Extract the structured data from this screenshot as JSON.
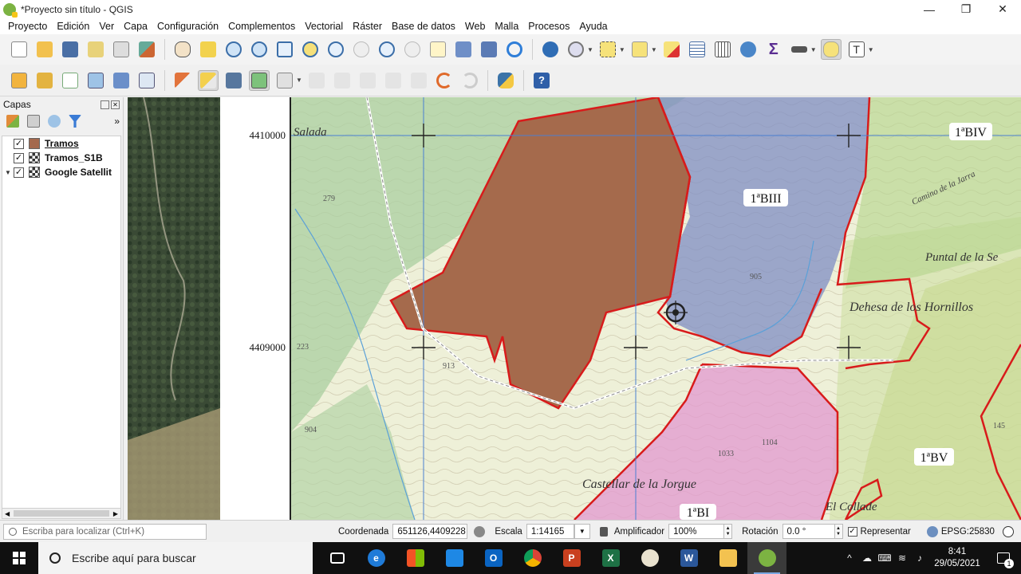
{
  "window": {
    "title": "*Proyecto sin título - QGIS",
    "minimize": "—",
    "maximize": "❐",
    "close": "✕"
  },
  "menu": [
    "Proyecto",
    "Edición",
    "Ver",
    "Capa",
    "Configuración",
    "Complementos",
    "Vectorial",
    "Ráster",
    "Base de datos",
    "Web",
    "Malla",
    "Procesos",
    "Ayuda"
  ],
  "colors": {
    "accent_line": "#d81b1b",
    "polygon_brown": "#a56a4c",
    "zone_blue": "#7f8dc4",
    "zone_pink": "#e39bd0",
    "zone_green": "#b7d68f"
  },
  "layers_panel": {
    "title": "Capas",
    "more": "»",
    "layers": [
      {
        "name": "Tramos",
        "checked": "✓",
        "symbol": "fill",
        "expander": ""
      },
      {
        "name": "Tramos_S1B",
        "checked": "✓",
        "symbol": "raster",
        "expander": ""
      },
      {
        "name": "Google Satellit",
        "checked": "✓",
        "symbol": "raster",
        "expander": "▼"
      }
    ]
  },
  "map": {
    "coord_labels": [
      "4410000",
      "4409000"
    ],
    "zone_labels": [
      "1ªBIV",
      "1ªBIII",
      "1ªBV",
      "1ªBI"
    ],
    "place_names": [
      "Dehesa de los Hornillos",
      "Castellar de la Jorgue",
      "Puntal de la Se",
      "El Collade",
      "Camino de la Jarra",
      "Salada"
    ],
    "elevations": [
      "279",
      "223",
      "913",
      "904",
      "905",
      "1033",
      "1104",
      "145"
    ]
  },
  "status": {
    "locator_placeholder": "Escriba para localizar (Ctrl+K)",
    "coordinate_label": "Coordenada",
    "coordinate_value": "651126,4409228",
    "scale_label": "Escala",
    "scale_value": "1:14165",
    "magnifier_label": "Amplificador",
    "magnifier_value": "100%",
    "rotation_label": "Rotación",
    "rotation_value": "0.0 °",
    "render_label": "Representar",
    "render_checked": "✓",
    "crs": "EPSG:25830"
  },
  "taskbar": {
    "search_placeholder": "Escribe aquí para buscar",
    "time": "8:41",
    "date": "29/05/2021",
    "notifications": "1"
  }
}
